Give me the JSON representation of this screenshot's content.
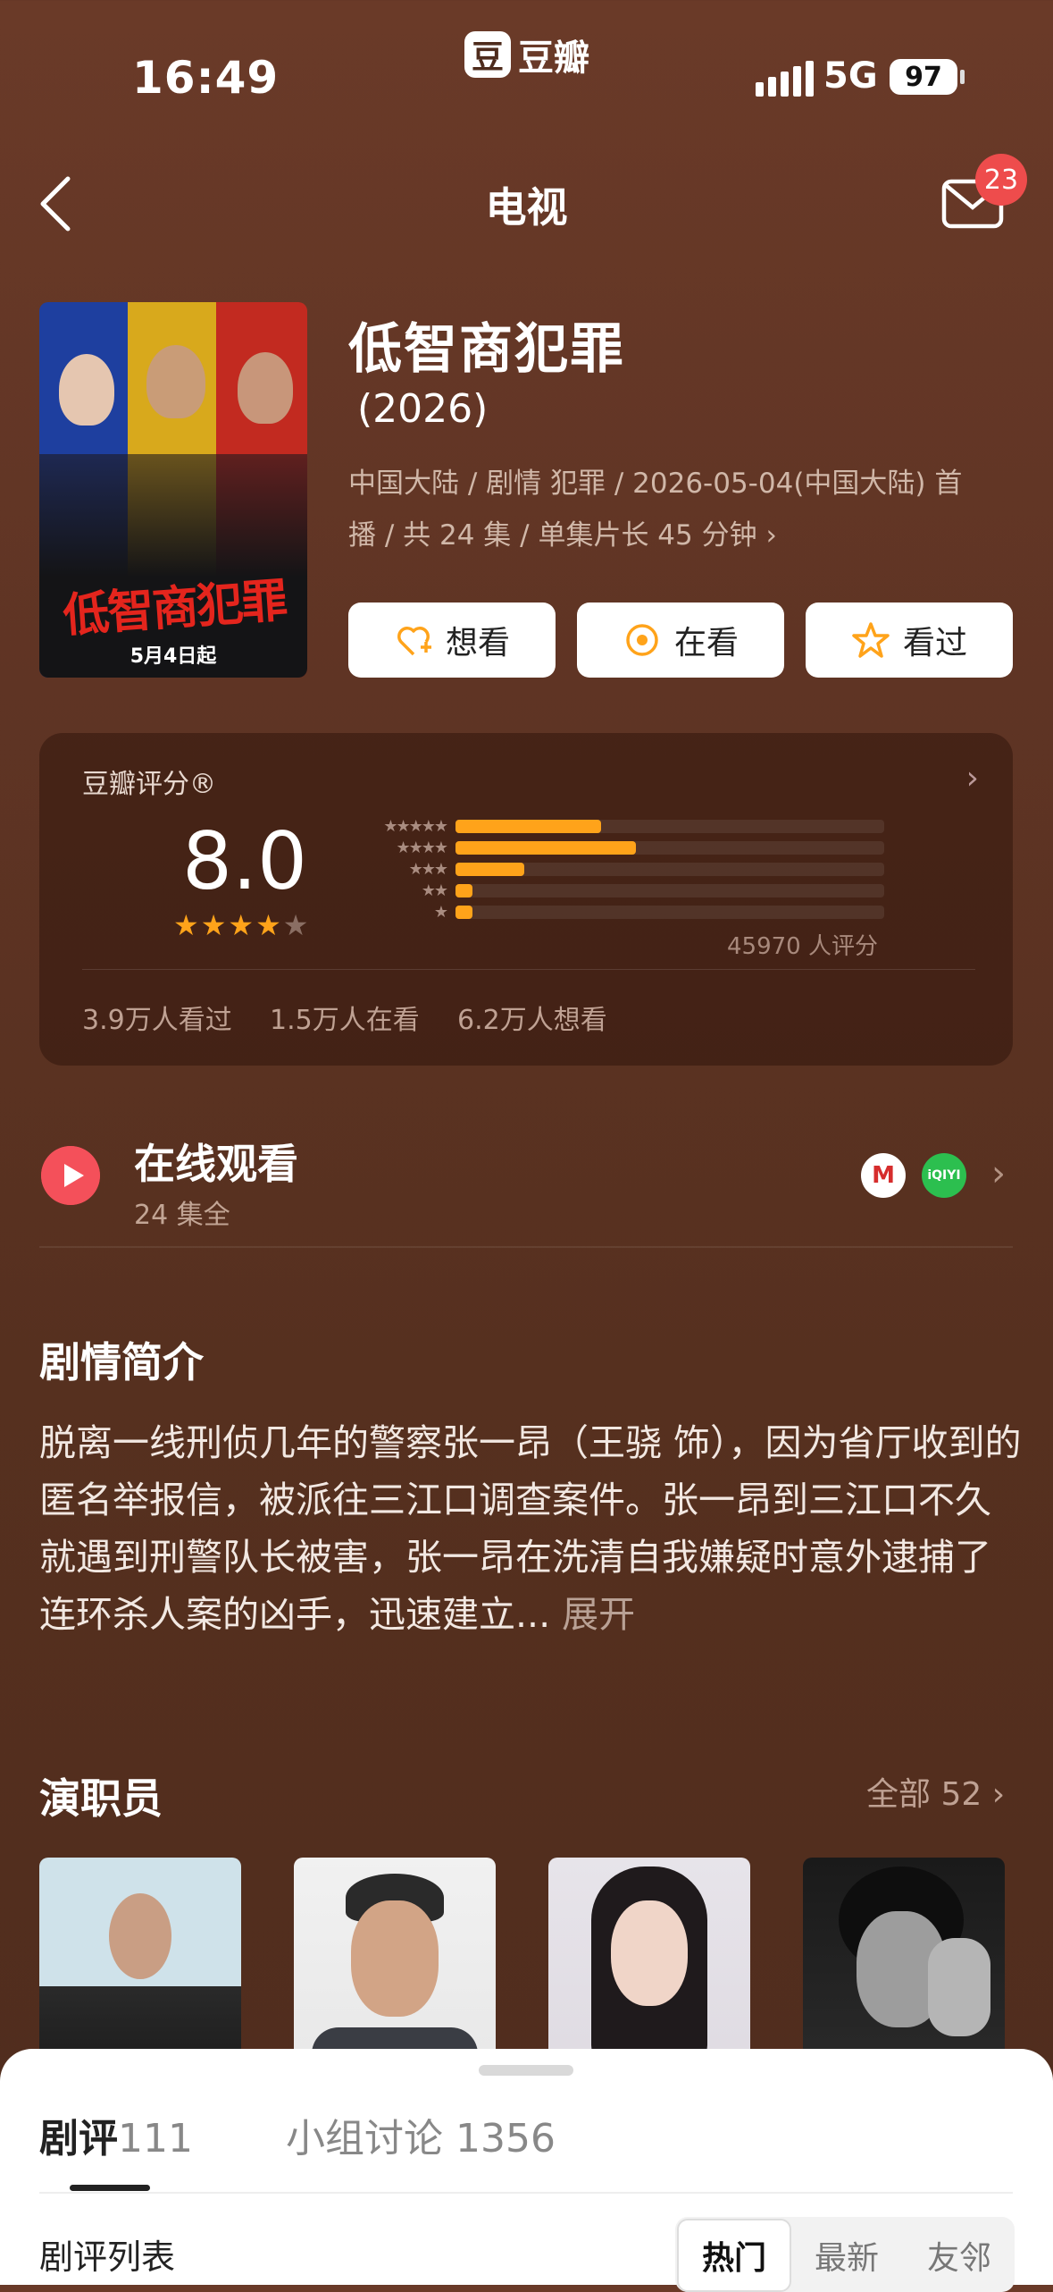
{
  "status_bar": {
    "time": "16:49",
    "network": "5G",
    "battery": "97"
  },
  "app_badge": {
    "logo_char": "豆",
    "name": "豆瓣"
  },
  "header": {
    "title": "电视",
    "mail_badge": "23"
  },
  "show": {
    "title": "低智商犯罪",
    "year": "(2026)",
    "meta_line1": "中国大陆 / 剧情 犯罪 / 2026-05-04(中国大陆) 首",
    "meta_line2": "播 / 共 24 集 / 单集片长 45 分钟",
    "poster_title": "低智商犯罪",
    "poster_date": "5月4日起"
  },
  "actions": {
    "want": "想看",
    "watching": "在看",
    "watched": "看过"
  },
  "rating": {
    "label": "豆瓣评分®",
    "score": "8.0",
    "stars_filled": 4,
    "count": "45970 人评分",
    "distribution": [
      0.34,
      0.42,
      0.16,
      0.04,
      0.04
    ],
    "stats": {
      "watched": "3.9万人看过",
      "watching": "1.5万人在看",
      "want": "6.2万人想看"
    }
  },
  "online": {
    "title": "在线观看",
    "subtitle": "24 集全",
    "platform2": "iQIYI"
  },
  "synopsis": {
    "heading": "剧情简介",
    "text": "脱离一线刑侦几年的警察张一昂（王骁 饰），因为省厅收到的匿名举报信，被派往三江口调查案件。张一昂到三江口不久就遇到刑警队长被害，张一昂在洗清自我嫌疑时意外逮捕了连环杀人案的凶手，迅速建立...",
    "more": "展开"
  },
  "cast": {
    "heading": "演职员",
    "all": "全部 52"
  },
  "sheet": {
    "tab1_label": "剧评",
    "tab1_count": "111",
    "tab2": "小组讨论 1356",
    "list_label": "剧评列表",
    "segments": [
      "热门",
      "最新",
      "友邻"
    ]
  },
  "colors": {
    "accent": "#ffa31a",
    "play": "#f4505a",
    "badge": "#ee4c4c"
  }
}
